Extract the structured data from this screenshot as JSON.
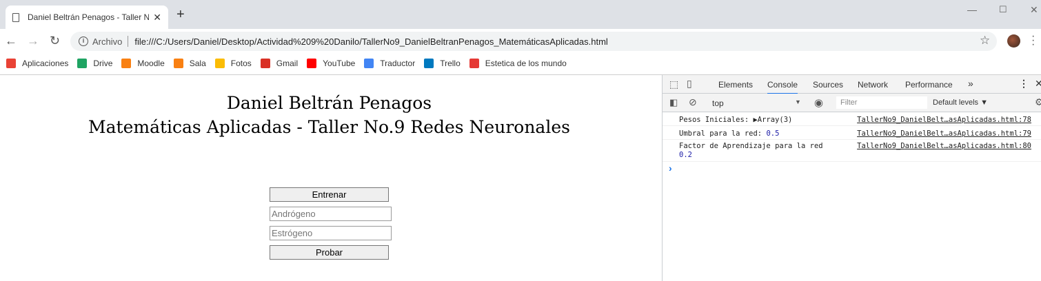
{
  "browser": {
    "tab_title": "Daniel Beltrán Penagos - Taller N",
    "tab_close": "✕",
    "new_tab": "+",
    "back": "←",
    "forward": "→",
    "reload": "↻",
    "url_security": "Archivo",
    "url": "file:///C:/Users/Daniel/Desktop/Actividad%209%20Danilo/TallerNo9_DanielBeltranPenagos_MatemáticasAplicadas.html",
    "bookmarks": [
      {
        "label": "Aplicaciones",
        "icon": "apps-grid-icon",
        "color": "#e94235"
      },
      {
        "label": "Drive",
        "icon": "drive-icon",
        "color": "#1fa463"
      },
      {
        "label": "Moodle",
        "icon": "moodle-icon",
        "color": "#f98012"
      },
      {
        "label": "Sala",
        "icon": "moodle-icon",
        "color": "#f98012"
      },
      {
        "label": "Fotos",
        "icon": "photos-icon",
        "color": "#fbbc04"
      },
      {
        "label": "Gmail",
        "icon": "gmail-icon",
        "color": "#d93025"
      },
      {
        "label": "YouTube",
        "icon": "youtube-icon",
        "color": "#ff0000"
      },
      {
        "label": "Traductor",
        "icon": "translate-icon",
        "color": "#4285f4"
      },
      {
        "label": "Trello",
        "icon": "trello-icon",
        "color": "#0079bf"
      },
      {
        "label": "Estetica de los mundo",
        "icon": "target-icon",
        "color": "#e53935"
      }
    ]
  },
  "page": {
    "title_line1": "Daniel Beltrán Penagos",
    "title_line2": "Matemáticas Aplicadas - Taller No.9 Redes Neuronales",
    "train_button": "Entrenar",
    "input1_placeholder": "Andrógeno",
    "input2_placeholder": "Estrógeno",
    "test_button": "Probar"
  },
  "devtools": {
    "tabs": [
      "Elements",
      "Console",
      "Sources",
      "Network",
      "Performance"
    ],
    "active_tab": "Console",
    "more": "»",
    "context": "top",
    "filter_placeholder": "Filter",
    "levels": "Default levels ▼",
    "console": [
      {
        "text": "Pesos Iniciales: ",
        "value": "▶Array(3)",
        "source": "TallerNo9_DanielBelt…asAplicadas.html:78"
      },
      {
        "text": "Umbral para la red: ",
        "value": "0.5",
        "source": "TallerNo9_DanielBelt…asAplicadas.html:79"
      },
      {
        "text": "Factor de Aprendizaje para la red",
        "value": "0.2",
        "source": "TallerNo9_DanielBelt…asAplicadas.html:80"
      }
    ],
    "prompt": "›"
  }
}
